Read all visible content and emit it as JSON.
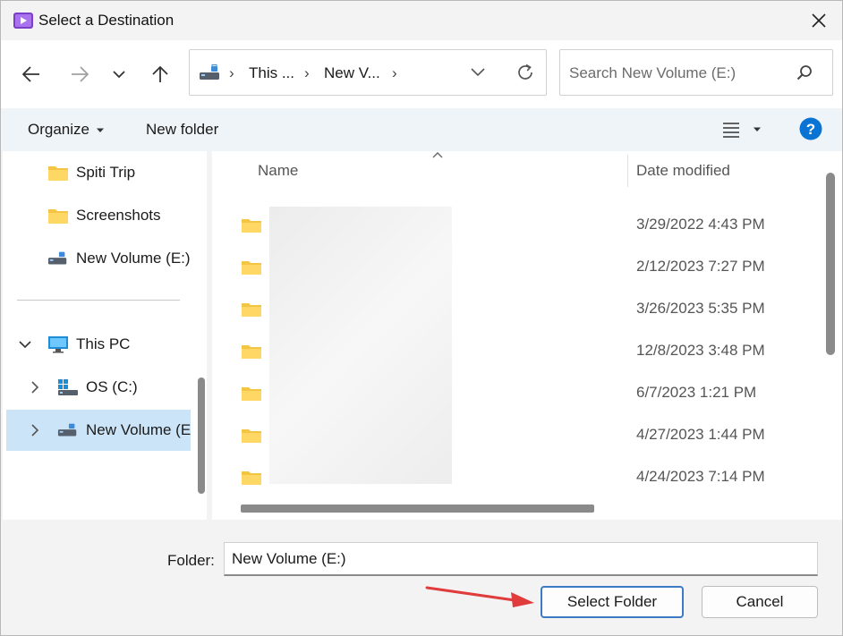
{
  "window": {
    "title": "Select a Destination"
  },
  "address": {
    "crumbs": [
      "This ...",
      "New V..."
    ]
  },
  "search": {
    "placeholder": "Search New Volume (E:)"
  },
  "commandbar": {
    "organize": "Organize",
    "new_folder": "New folder"
  },
  "navpane": {
    "items": [
      {
        "label": "Spiti Trip",
        "icon": "folder-icon"
      },
      {
        "label": "Screenshots",
        "icon": "folder-icon"
      },
      {
        "label": "New Volume (E:)",
        "icon": "drive-icon"
      },
      {
        "label": "This PC",
        "icon": "computer-icon"
      },
      {
        "label": "OS (C:)",
        "icon": "windows-drive-icon"
      },
      {
        "label": "New Volume (E",
        "icon": "drive-icon",
        "selected": true
      }
    ]
  },
  "filelist": {
    "columns": {
      "name": "Name",
      "date": "Date modified"
    },
    "rows": [
      {
        "date": "3/29/2022 4:43 PM"
      },
      {
        "date": "2/12/2023 7:27 PM"
      },
      {
        "date": "3/26/2023 5:35 PM"
      },
      {
        "date": "12/8/2023 3:48 PM"
      },
      {
        "date": "6/7/2023 1:21 PM"
      },
      {
        "date": "4/27/2023 1:44 PM"
      },
      {
        "date": "4/24/2023 7:14 PM"
      }
    ]
  },
  "footer": {
    "folder_label": "Folder:",
    "folder_value": "New Volume (E:)",
    "select_button": "Select Folder",
    "cancel_button": "Cancel"
  },
  "colors": {
    "accent": "#0067c0",
    "selection": "#cce4f7",
    "annotation_arrow": "#e03c3c"
  }
}
